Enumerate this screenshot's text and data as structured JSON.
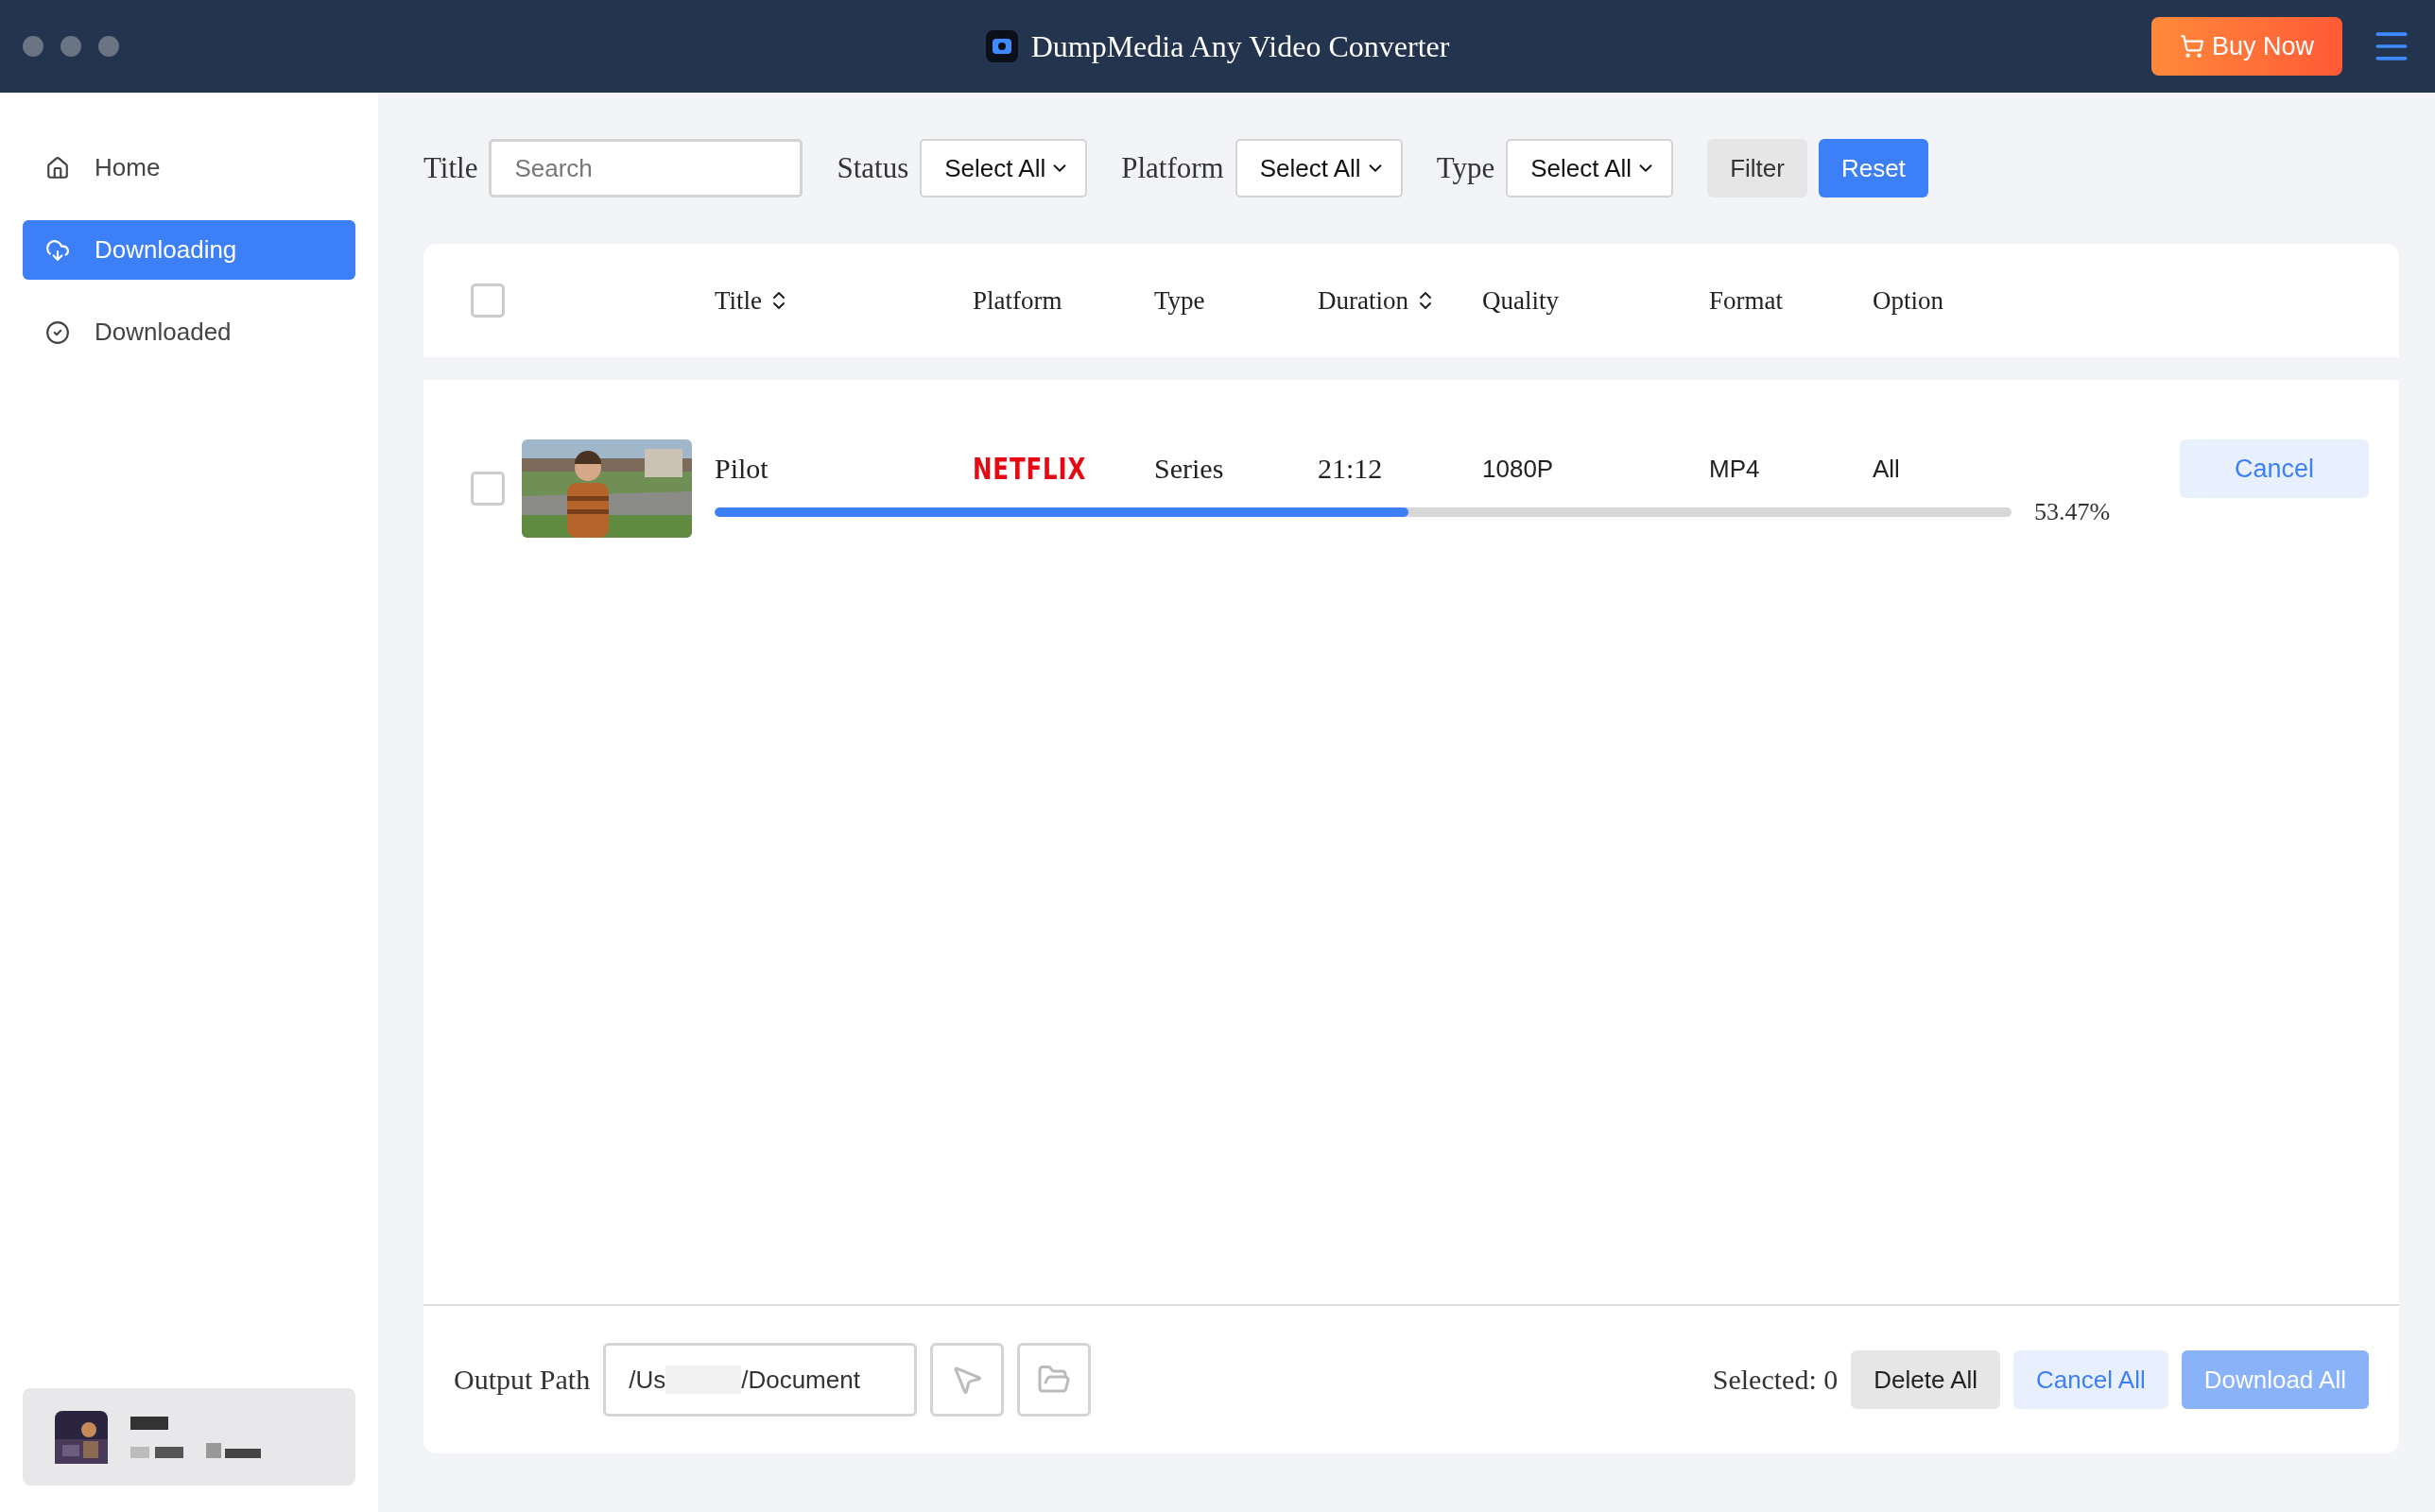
{
  "window": {
    "title": "DumpMedia Any Video Converter",
    "buy_button": "Buy Now"
  },
  "sidebar": {
    "items": [
      {
        "label": "Home",
        "selected": false
      },
      {
        "label": "Downloading",
        "selected": true
      },
      {
        "label": "Downloaded",
        "selected": false
      }
    ]
  },
  "filters": {
    "title_label": "Title",
    "search": {
      "placeholder": "Search"
    },
    "selects": [
      {
        "label": "Status",
        "value": "Select All"
      },
      {
        "label": "Platform",
        "value": "Select All"
      },
      {
        "label": "Type",
        "value": "Select All"
      }
    ],
    "buttons": [
      {
        "label": "Filter",
        "kind": "neutral"
      },
      {
        "label": "Reset",
        "kind": "primary"
      }
    ]
  },
  "table": {
    "select_all_checked": false,
    "columns": [
      {
        "label": "Title",
        "sortable": true
      },
      {
        "label": "Platform",
        "sortable": false
      },
      {
        "label": "Type",
        "sortable": false
      },
      {
        "label": "Duration",
        "sortable": true
      },
      {
        "label": "Quality",
        "sortable": false
      },
      {
        "label": "Format",
        "sortable": false
      },
      {
        "label": "Option",
        "sortable": false
      }
    ],
    "rows": [
      {
        "checked": false,
        "title": "Pilot",
        "platform": "NETFLIX",
        "type": "Series",
        "duration": "21:12",
        "quality": "1080P",
        "format": "MP4",
        "option": "All",
        "level": 0.5347,
        "percent": "53.47%",
        "action": "Cancel"
      }
    ]
  },
  "footer": {
    "output_label": "Output Path",
    "path_start": "/Us",
    "path_end": "/Document",
    "selected": "Selected: 0",
    "buttons": [
      {
        "label": "Delete All",
        "kind": "neutral",
        "disabled": false
      },
      {
        "label": "Cancel All",
        "kind": "light",
        "disabled": false
      },
      {
        "label": "Download All",
        "kind": "primary",
        "disabled": true
      }
    ]
  }
}
